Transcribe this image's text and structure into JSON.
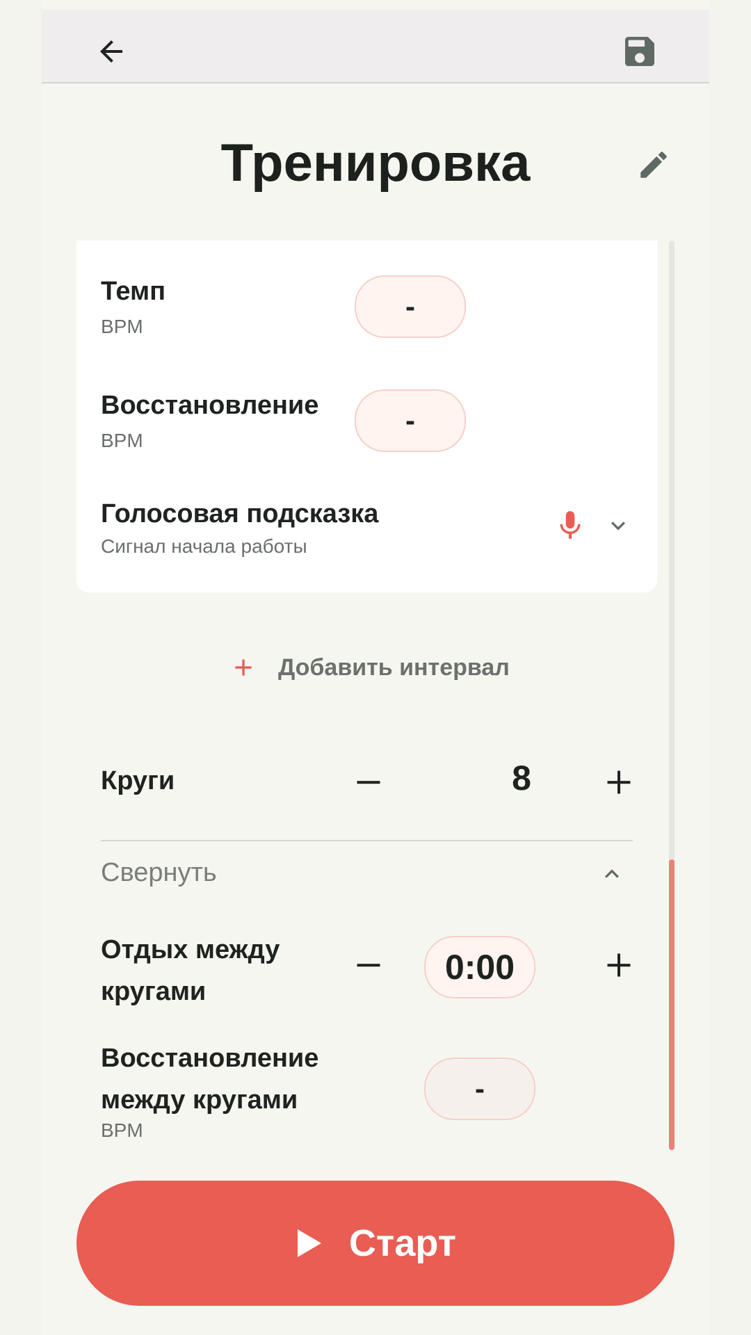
{
  "header": {
    "back_icon": "arrow-left-icon",
    "save_icon": "floppy-disk-icon"
  },
  "title": "Тренировка",
  "edit_icon": "pencil-icon",
  "card": {
    "tempo": {
      "label": "Темп",
      "unit": "BPM",
      "value": "-"
    },
    "recovery": {
      "label": "Восстановление",
      "unit": "BPM",
      "value": "-"
    },
    "voice": {
      "label": "Голосовая подсказка",
      "subtitle": "Сигнал начала работы",
      "icon": "microphone-icon"
    }
  },
  "add_interval": {
    "label": "Добавить интервал",
    "icon": "plus-icon"
  },
  "laps": {
    "label": "Круги",
    "value": "8"
  },
  "collapse": {
    "label": "Свернуть"
  },
  "rest_between_laps": {
    "label_line1": "Отдых между",
    "label_line2": "кругами",
    "value": "0:00"
  },
  "recovery_between_laps": {
    "label_line1": "Восстановление",
    "label_line2": "между кругами",
    "unit": "BPM",
    "value": "-"
  },
  "start": {
    "label": "Старт",
    "icon": "play-icon"
  },
  "colors": {
    "accent": "#e95d52",
    "background": "#f6f6f1",
    "pill_background": "#fff4f0",
    "pill_border": "#f6d0c8",
    "scroll_thumb": "#ea8276"
  }
}
